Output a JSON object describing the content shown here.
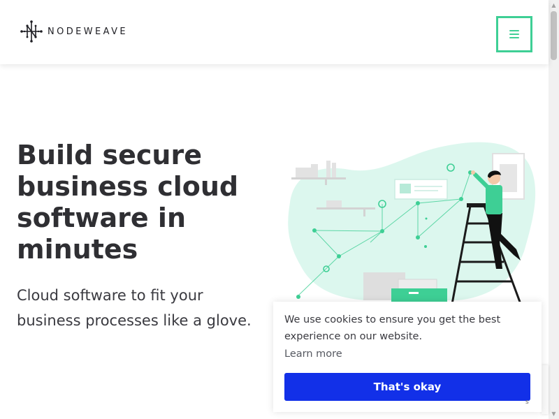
{
  "header": {
    "logo_text": "NODEWEAVE",
    "menu_icon": "hamburger-menu-icon",
    "accent_color": "#3ecf95"
  },
  "hero": {
    "headline": "Build secure business cloud software in minutes",
    "subheadline": "Cloud software to fit your business processes like a glove.",
    "illustration": "person-on-ladder-network-illustration"
  },
  "cookie_banner": {
    "message": "We use cookies to ensure you get the best experience on our website.",
    "learn_more": "Learn more",
    "accept_label": "That's okay",
    "button_color": "#1230e8"
  },
  "recaptcha": {
    "terms": "s"
  }
}
